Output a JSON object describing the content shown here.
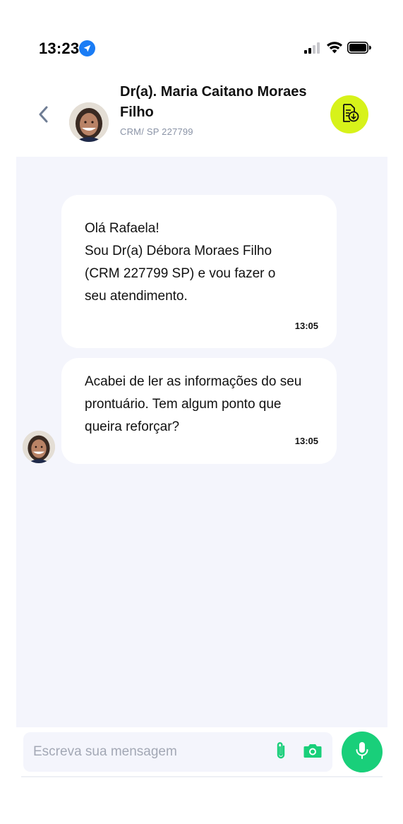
{
  "status_bar": {
    "time": "13:23",
    "icons": [
      "location-arrow-icon",
      "cellular-signal-icon",
      "wifi-icon",
      "battery-icon"
    ]
  },
  "header": {
    "back_icon": "chevron-left-icon",
    "doctor_name": "Dr(a). Maria Caitano Moraes Filho",
    "crm": "CRM/ SP 227799",
    "action_icon": "document-download-icon",
    "action_color": "#d7f21a"
  },
  "messages": [
    {
      "text": "Olá Rafaela!\nSou Dr(a) Débora Moraes Filho (CRM 227799 SP) e vou fazer o seu atendimento.",
      "time": "13:05"
    },
    {
      "text": "Acabei de ler as informações do seu prontuário. Tem algum ponto que queira reforçar?",
      "time": "13:05"
    }
  ],
  "composer": {
    "placeholder": "Escreva sua mensagem",
    "value": "",
    "attach_icon": "paperclip-icon",
    "camera_icon": "camera-icon",
    "mic_icon": "microphone-icon",
    "accent_color": "#19cf7a"
  },
  "colors": {
    "chat_background": "#f4f5fc",
    "bubble_background": "#ffffff",
    "muted_text": "#8a93a6"
  }
}
